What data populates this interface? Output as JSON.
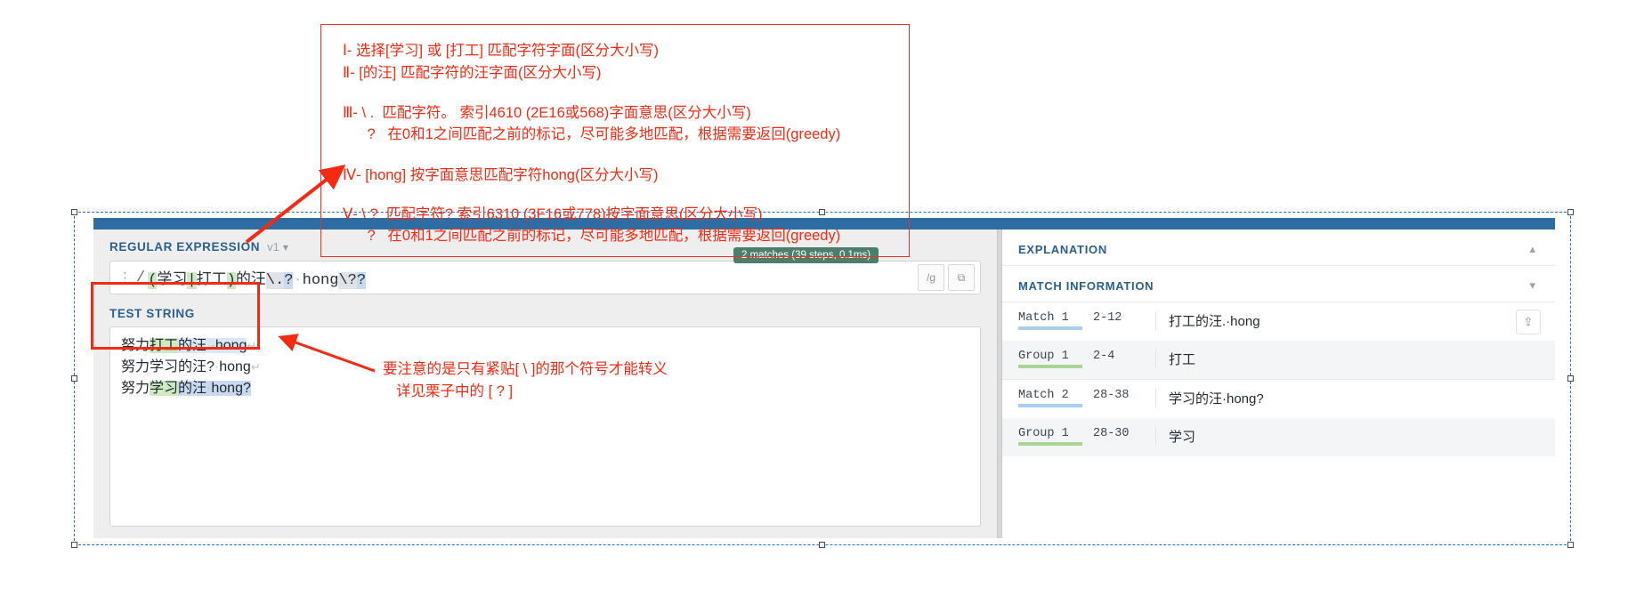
{
  "app": {
    "regex_section": {
      "label": "REGULAR EXPRESSION",
      "version": "v1",
      "chevron": "chevron-down-icon",
      "delimiter": "/",
      "pattern_plain": "(学习|打工)的汪\\.?·hong\\??",
      "pattern_tokens": [
        {
          "text": "(",
          "style": "green"
        },
        {
          "text": "学习",
          "style": "none"
        },
        {
          "text": "|",
          "style": "green"
        },
        {
          "text": "打工",
          "style": "none"
        },
        {
          "text": ")",
          "style": "green"
        },
        {
          "text": "的汪",
          "style": "none"
        },
        {
          "text": "\\.",
          "style": "grey"
        },
        {
          "text": "?",
          "style": "blue"
        },
        {
          "text": "·hong",
          "style": "none"
        },
        {
          "text": "\\?",
          "style": "grey"
        },
        {
          "text": "?",
          "style": "blue"
        }
      ]
    },
    "match_badge": "2 matches (39 steps, 0.1ms)",
    "test_section": {
      "label": "TEST STRING",
      "lines": [
        {
          "segments": [
            {
              "text": "努力",
              "style": "none"
            },
            {
              "text": "打工",
              "style": "green"
            },
            {
              "text": "的汪.·hong",
              "style": "blue"
            }
          ],
          "newline_mark": "↵"
        },
        {
          "segments": [
            {
              "text": "努力学习的汪?·hong",
              "style": "none"
            }
          ],
          "newline_mark": "↵"
        },
        {
          "segments": [
            {
              "text": "努力",
              "style": "none"
            },
            {
              "text": "学习",
              "style": "green"
            },
            {
              "text": "的汪·hong?",
              "style": "blue"
            }
          ],
          "newline_mark": ""
        }
      ]
    },
    "right_pane": {
      "explanation_title": "EXPLANATION",
      "explanation_caret": "chevron-up-icon",
      "match_info_title": "MATCH INFORMATION",
      "match_info_caret": "chevron-down-icon",
      "export_icon": "export-icon",
      "rows": [
        {
          "key": "Match 1",
          "kind": "match",
          "range": "2-12",
          "value": "打工的汪.·hong"
        },
        {
          "key": "Group 1",
          "kind": "group",
          "range": "2-4",
          "value": "打工"
        },
        {
          "key": "Match 2",
          "kind": "match",
          "range": "28-38",
          "value": "学习的汪·hong?"
        },
        {
          "key": "Group 1",
          "kind": "group",
          "range": "28-30",
          "value": "学习"
        }
      ]
    }
  },
  "annotations": {
    "color": "#f42a12",
    "lines": [
      "Ⅰ- 选择[学习] 或 [打工] 匹配字符字面(区分大小写)",
      "Ⅱ- [的汪] 匹配字符的汪字面(区分大小写)",
      "Ⅲ- \\ .  匹配字符。 索引4610 (2E16或568)字面意思(区分大小写)",
      "      ?   在0和1之间匹配之前的标记，尽可能多地匹配，根据需要返回(greedy)",
      "Ⅳ- [hong] 按字面意思匹配字符hong(区分大小写)",
      "Ⅴ- \\ ?  匹配字符? 索引6310 (3F16或778)按字面意思(区分大小写)",
      "      ?   在0和1之间匹配之前的标记，尽可能多地匹配，根据需要返回(greedy)"
    ],
    "bottom_note_line1": "要注意的是只有紧贴[ \\ ]的那个符号才能转义",
    "bottom_note_line2": "详见栗子中的 [ ? ]"
  }
}
